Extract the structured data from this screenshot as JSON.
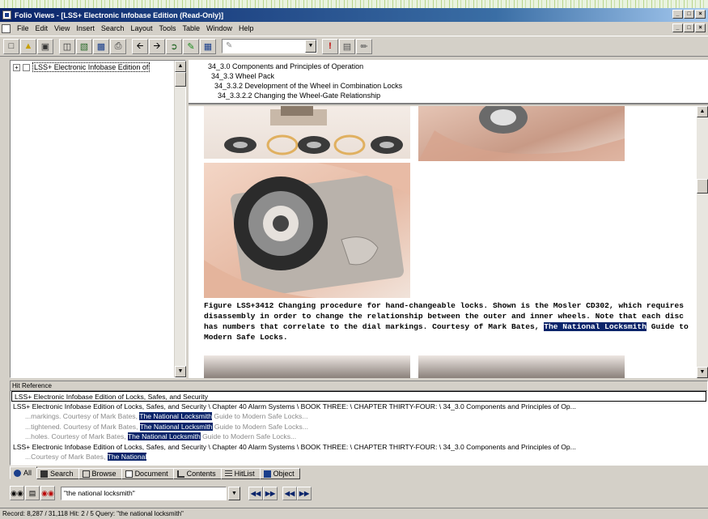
{
  "window": {
    "title": "Folio Views - [LSS+ Electronic Infobase Edition  (Read-Only)]",
    "controls": [
      "_",
      "□",
      "×"
    ]
  },
  "menubar": {
    "items": [
      "File",
      "Edit",
      "View",
      "Insert",
      "Search",
      "Layout",
      "Tools",
      "Table",
      "Window",
      "Help"
    ]
  },
  "toolbar": {
    "buttons": [
      "new-icon",
      "open-icon",
      "save-icon",
      "print-icon",
      "print-preview-icon",
      "image-icon",
      "back-icon",
      "forward-icon",
      "jump-icon",
      "highlighter-icon",
      "view-icon"
    ],
    "style_value": ""
  },
  "tree": {
    "root_label": "LSS+ Electronic Infobase Edition of"
  },
  "breadcrumbs": [
    "34_3.0 Components and Principles of Operation",
    "34_3.3 Wheel Pack",
    "34_3.3.2 Development of the Wheel in Combination Locks",
    "34_3.3.2.2 Changing the Wheel-Gate Relationship"
  ],
  "document": {
    "caption_before": "Figure LSS+3412 Changing procedure for hand-changeable locks. Shown is the Mosler CD302, which requires disassembly in order to change the relationship between the outer and inner wheels. Note that each disc has numbers that correlate to the dial markings. Courtesy of Mark Bates, ",
    "caption_highlight": "The National Locksmith",
    "caption_after": " Guide to Modern Safe Locks."
  },
  "hit_reference": {
    "title": "Hit Reference",
    "rows": [
      {
        "text": "LSS+ Electronic Infobase Edition of Locks, Safes, and Security",
        "kind": "selected"
      },
      {
        "text": "LSS+ Electronic Infobase Edition of Locks, Safes, and Security \\ Chapter 40 Alarm Systems \\ BOOK THREE: \\ CHAPTER THIRTY-FOUR: \\ 34_3.0 Components and Principles of Op...",
        "kind": "path"
      },
      {
        "before": "...markings. Courtesy of Mark Bates, ",
        "hl": "The National Locksmith",
        "after": " Guide to Modern Safe Locks...",
        "kind": "snippet"
      },
      {
        "before": "...tightened. Courtesy of Mark Bates, ",
        "hl": "The National Locksmith",
        "after": " Guide to Modern Safe Locks...",
        "kind": "snippet"
      },
      {
        "before": "...holes. Courtesy of Mark Bates, ",
        "hl": "The National Locksmith",
        "after": " Guide to Modern Safe Locks...",
        "kind": "snippet"
      },
      {
        "text": "LSS+ Electronic Infobase Edition of Locks, Safes, and Security \\ Chapter 40 Alarm Systems \\ BOOK THREE: \\ CHAPTER THIRTY-FOUR: \\ 34_3.0 Components and Principles of Op...",
        "kind": "path"
      },
      {
        "before": "...Courtesy of Mark Bates, ",
        "hl": "The National",
        "after": "",
        "kind": "snippet"
      }
    ]
  },
  "tabs": [
    {
      "label": "All",
      "icon": "globe-icon",
      "active": true
    },
    {
      "label": "Search",
      "icon": "binoculars-icon",
      "active": false
    },
    {
      "label": "Browse",
      "icon": "book-icon",
      "active": false
    },
    {
      "label": "Document",
      "icon": "document-icon",
      "active": false
    },
    {
      "label": "Contents",
      "icon": "contents-icon",
      "active": false
    },
    {
      "label": "HitList",
      "icon": "list-icon",
      "active": false
    },
    {
      "label": "Object",
      "icon": "object-icon",
      "active": false
    }
  ],
  "query": {
    "value": "\"the national locksmith\"",
    "nav_buttons": [
      "◀◀",
      "▶▶",
      "◀◀",
      "▶▶"
    ]
  },
  "status": {
    "text": "Record: 8,287 / 31,118  Hit: 2 / 5  Query: \"the national locksmith\""
  },
  "colors": {
    "highlight_bg": "#0a246a",
    "title_bar": "#0a246a",
    "chrome": "#d4d0c8"
  }
}
